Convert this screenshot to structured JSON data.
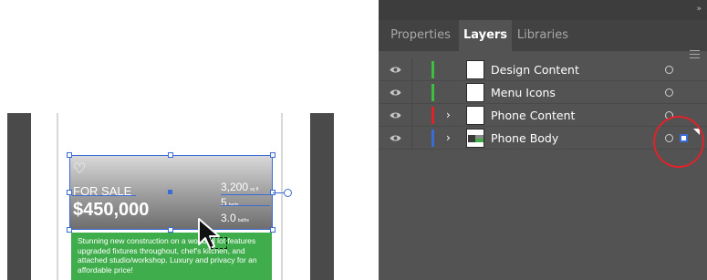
{
  "artboard": {
    "heart_glyph": "♡",
    "for_sale": "FOR SALE",
    "price": "$450,000",
    "stats": [
      {
        "num": "3,200",
        "unit": "sq ft"
      },
      {
        "num": "5",
        "unit": "beds"
      },
      {
        "num": "3.0",
        "unit": "baths"
      }
    ],
    "description": "Stunning new construction on a wooded lot features upgraded fixtures throughout, chef's kitchen, and attached studio/workshop. Luxury and privacy for an affordable price!"
  },
  "panel": {
    "collapse_glyph": "»",
    "tabs": [
      {
        "label": "Properties",
        "active": false
      },
      {
        "label": "Layers",
        "active": true
      },
      {
        "label": "Libraries",
        "active": false
      }
    ],
    "layers": [
      {
        "name": "Design Content",
        "color": "#3fbf3f",
        "expandable": false
      },
      {
        "name": "Menu Icons",
        "color": "#3fbf3f",
        "expandable": false
      },
      {
        "name": "Phone Content",
        "color": "#e0232a",
        "expandable": true
      },
      {
        "name": "Phone Body",
        "color": "#3b6cd6",
        "expandable": true
      }
    ],
    "expand_glyph": "›"
  },
  "colors": {
    "selection": "#3b6cd6",
    "highlight_circle": "#e0232a",
    "panel_bg": "#535353",
    "green_block": "#3fad4b"
  }
}
